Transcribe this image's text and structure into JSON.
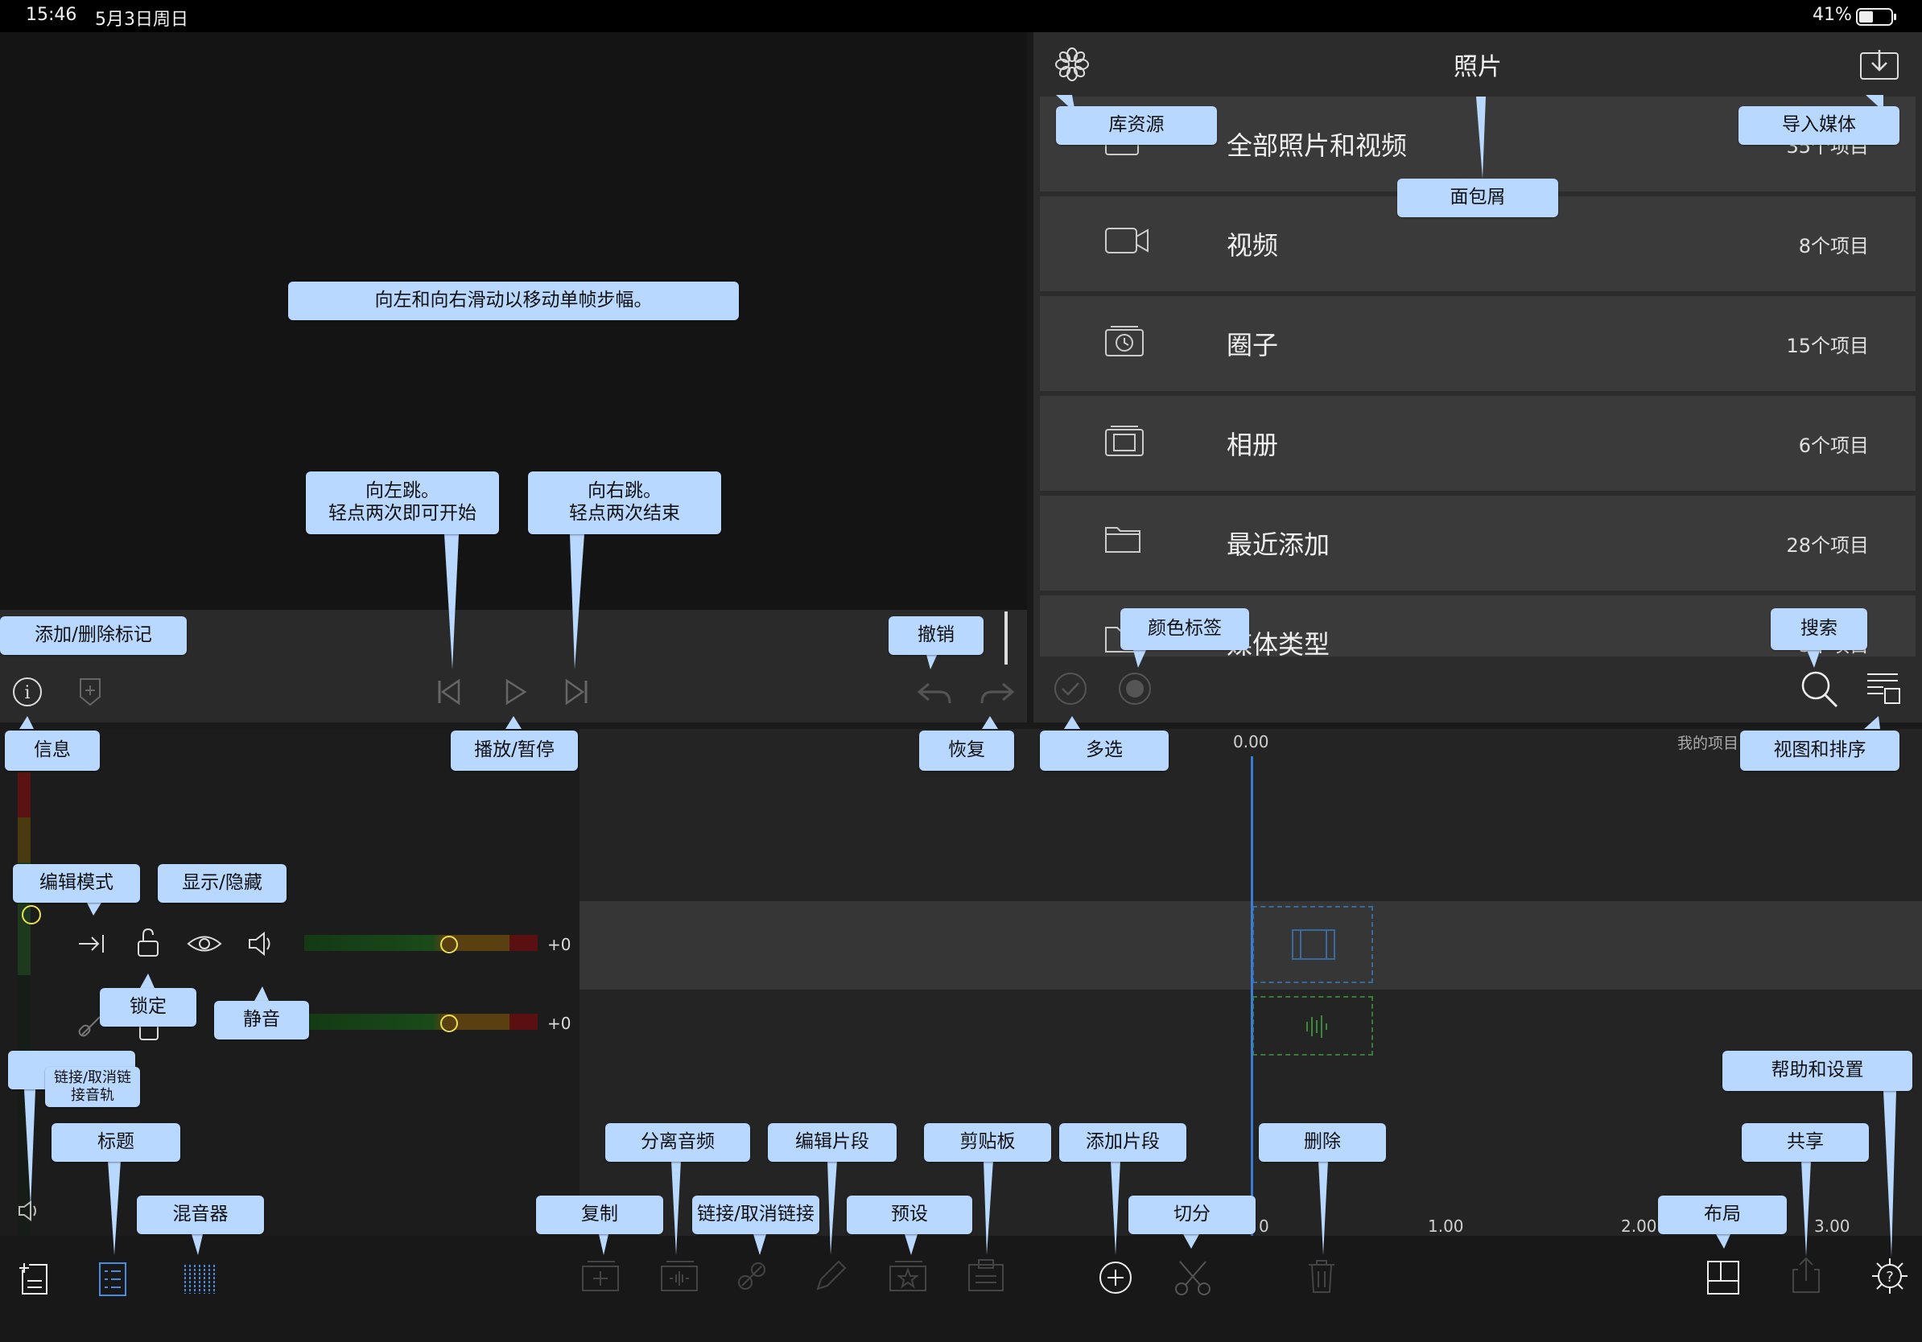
{
  "status_bar": {
    "time": "15:46",
    "date": "5月3日周日",
    "battery": "41%"
  },
  "library": {
    "title": "照片",
    "rows": [
      {
        "label": "全部照片和视频",
        "count": "35个项目",
        "icon": "photos-library-icon"
      },
      {
        "label": "视频",
        "count": "8个项目",
        "icon": "video-camera-icon"
      },
      {
        "label": "圈子",
        "count": "15个项目",
        "icon": "moments-icon"
      },
      {
        "label": "相册",
        "count": "6个项目",
        "icon": "album-icon"
      },
      {
        "label": "最近添加",
        "count": "28个项目",
        "icon": "folder-icon"
      },
      {
        "label": "媒体类型",
        "count": "3个项目",
        "icon": "folder-icon"
      }
    ]
  },
  "timeline": {
    "playhead": "0.00",
    "project_name": "我的项目",
    "ruler": [
      "0",
      "1.00",
      "2.00",
      "3.00"
    ],
    "vol_video": "+0",
    "vol_audio": "+0"
  },
  "callouts": {
    "library_source": "库资源",
    "import_media": "导入媒体",
    "breadcrumb": "面包屑",
    "swipe_hint": "向左和向右滑动以移动单帧步幅。",
    "jump_left": "向左跳。\n轻点两次即可开始",
    "jump_right": "向右跳。\n轻点两次结束",
    "add_marker": "添加/删除标记",
    "undo": "撤销",
    "color_label": "颜色标签",
    "search": "搜索",
    "info": "信息",
    "play_pause": "播放/暂停",
    "redo": "恢复",
    "multi_select": "多选",
    "view_sort": "视图和排序",
    "edit_mode": "编辑模式",
    "show_hide": "显示/隐藏",
    "lock": "锁定",
    "mute": "静音",
    "link_track": "链接/取消链\n接音轨",
    "title": "标题",
    "mixer": "混音器",
    "detach_audio": "分离音频",
    "edit_clip": "编辑片段",
    "clipboard": "剪贴板",
    "add_clip": "添加片段",
    "delete": "删除",
    "help_settings": "帮助和设置",
    "share": "共享",
    "copy": "复制",
    "link_unlink": "链接/取消链接",
    "preset": "预设",
    "split": "切分",
    "layout": "布局"
  },
  "colors": {
    "callout": "#b8d8ff",
    "accent": "#3a7bd5",
    "panel": "#2c2c2c"
  }
}
